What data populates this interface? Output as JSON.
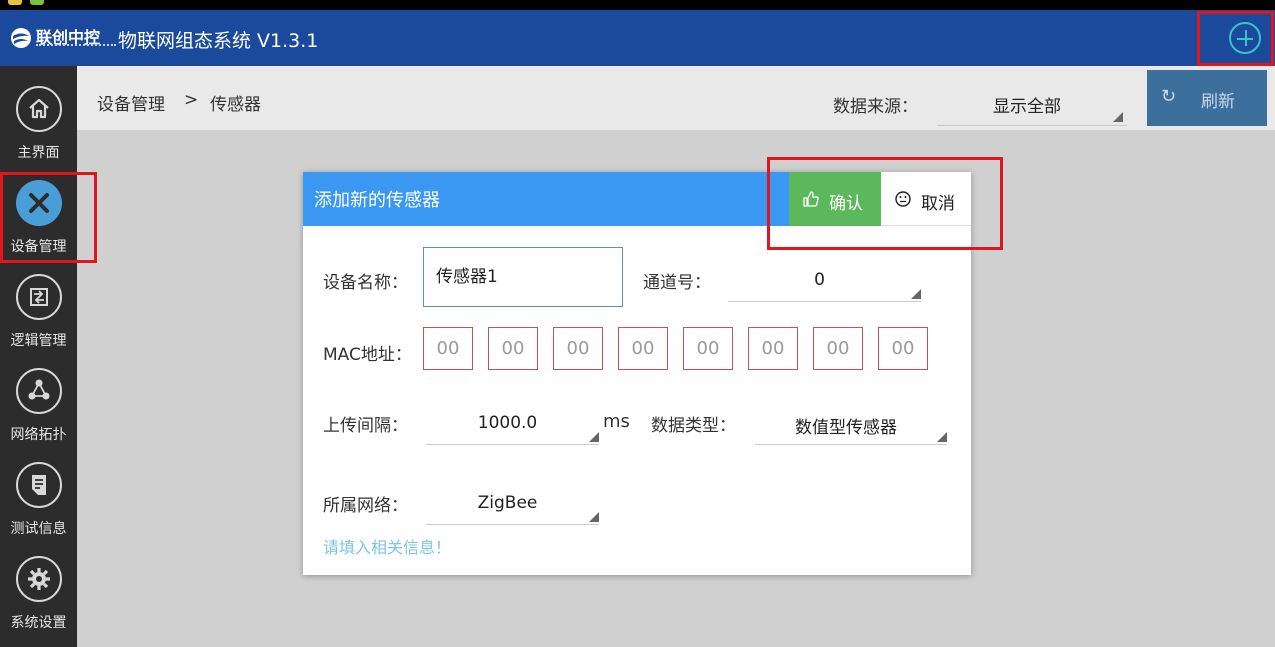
{
  "app": {
    "logo_text": "联创中控",
    "title": "物联网组态系统 V1.3.1"
  },
  "sidebar": {
    "items": [
      {
        "label": "主界面",
        "icon": "home-icon"
      },
      {
        "label": "设备管理",
        "icon": "tools-icon",
        "active": true
      },
      {
        "label": "逻辑管理",
        "icon": "logic-icon"
      },
      {
        "label": "网络拓扑",
        "icon": "topology-icon"
      },
      {
        "label": "测试信息",
        "icon": "document-icon"
      },
      {
        "label": "系统设置",
        "icon": "gear-icon"
      }
    ]
  },
  "breadcrumb": {
    "root": "设备管理",
    "separator": ">",
    "current": "传感器"
  },
  "toolbar": {
    "data_source_label": "数据来源：",
    "data_source_value": "显示全部",
    "refresh_label": "刷新"
  },
  "dialog": {
    "title": "添加新的传感器",
    "confirm_label": "确认",
    "cancel_label": "取消",
    "device_name_label": "设备名称：",
    "device_name_value": "传感器1",
    "channel_label": "通道号：",
    "channel_value": "0",
    "mac_label": "MAC地址：",
    "mac_values": [
      "00",
      "00",
      "00",
      "00",
      "00",
      "00",
      "00",
      "00"
    ],
    "upload_interval_label": "上传间隔：",
    "upload_interval_value": "1000.0",
    "upload_interval_unit": "ms",
    "data_type_label": "数据类型：",
    "data_type_value": "数值型传感器",
    "network_label": "所属网络：",
    "network_value": "ZigBee",
    "hint": "请填入相关信息！"
  },
  "colors": {
    "appbar": "#1b4a9c",
    "sidebar": "#2c2c2c",
    "dialog_header": "#3a97f2",
    "confirm": "#5cb85c",
    "highlight": "#e0161d",
    "mac_border": "#c95050"
  }
}
